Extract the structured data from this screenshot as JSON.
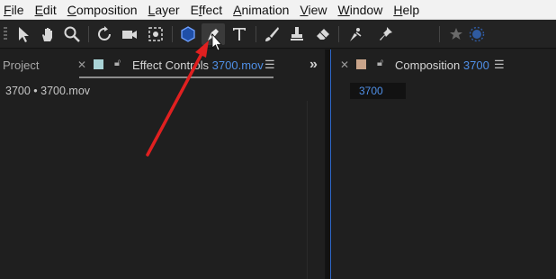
{
  "menu": {
    "file": "File",
    "edit": "Edit",
    "composition": "Composition",
    "layer": "Layer",
    "effect": "Effect",
    "animation": "Animation",
    "view": "View",
    "window": "Window",
    "help": "Help"
  },
  "toolbar": {
    "tools": [
      "selection-tool",
      "hand-tool",
      "zoom-tool",
      "rotation-tool",
      "camera-tool",
      "pan-behind-tool",
      "shape-tool",
      "pen-tool",
      "type-tool",
      "brush-tool",
      "clone-stamp-tool",
      "eraser-tool",
      "roto-brush-tool",
      "puppet-pin-tool"
    ],
    "active_tool": "pen-tool"
  },
  "left_panel": {
    "project_tab": "Project",
    "effect_controls_tab": "Effect Controls",
    "effect_controls_file": "3700.mov",
    "breadcrumb": "3700 • 3700.mov",
    "swatch_color": "#a9d3d6"
  },
  "right_panel": {
    "composition_tab": "Composition",
    "composition_name": "3700",
    "comp_chip": "3700",
    "swatch_color": "#c9a48a"
  },
  "colors": {
    "accent": "#4f8fe6",
    "annotation_arrow": "#e02020"
  }
}
